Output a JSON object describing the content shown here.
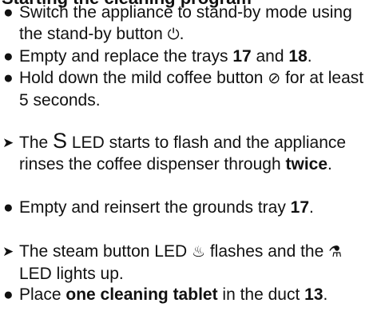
{
  "heading": "Starting the cleaning program",
  "items": [
    {
      "marker": "●",
      "parts": [
        "Switch the appliance to stand-by mode using the stand-by button ",
        "⏻",
        "."
      ]
    },
    {
      "marker": "●",
      "parts": [
        "Empty and replace the trays ",
        "17",
        " and ",
        "18",
        "."
      ]
    },
    {
      "marker": "●",
      "parts": [
        "Hold down the mild coffee button ",
        "⊘",
        " for at least 5 seconds."
      ]
    },
    {
      "marker": "➤",
      "parts": [
        "The ",
        "S",
        " LED starts to flash and the appliance rinses the coffee dispenser through ",
        "twice",
        "."
      ]
    },
    {
      "marker": "●",
      "parts": [
        "Empty and reinsert the grounds tray ",
        "17",
        "."
      ]
    },
    {
      "marker": "➤",
      "parts": [
        "The steam button LED ",
        "♨",
        " flashes and the ",
        "⚗",
        " LED lights up."
      ]
    },
    {
      "marker": "●",
      "parts": [
        "Place ",
        "one cleaning tablet",
        " in the duct ",
        "13",
        "."
      ]
    }
  ]
}
